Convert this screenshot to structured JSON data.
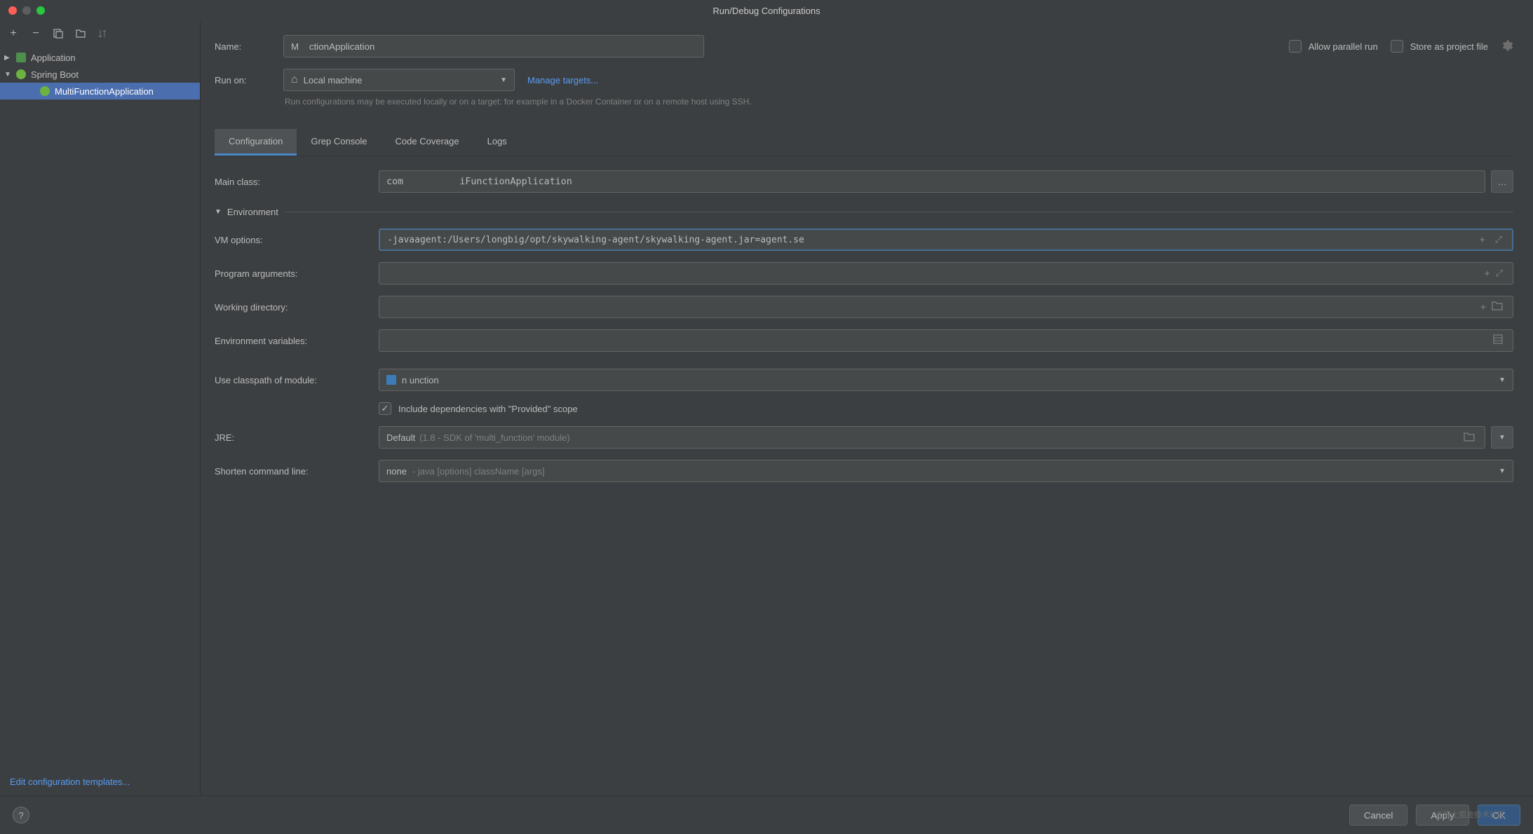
{
  "window": {
    "title": "Run/Debug Configurations"
  },
  "toolbar": {
    "add": "+",
    "remove": "−"
  },
  "sidebar": {
    "nodes": [
      {
        "label": "Application",
        "expanded": false,
        "type": "app"
      },
      {
        "label": "Spring Boot",
        "expanded": true,
        "type": "spring",
        "children": [
          {
            "label": "MultiFunctionApplication",
            "selected": true
          }
        ]
      }
    ],
    "edit_templates": "Edit configuration templates..."
  },
  "form": {
    "name_label": "Name:",
    "name_value": "M    ctionApplication",
    "allow_parallel": "Allow parallel run",
    "store_as_project": "Store as project file",
    "run_on_label": "Run on:",
    "run_on_value": "Local machine",
    "manage_targets": "Manage targets...",
    "run_on_hint": "Run configurations may be executed locally or on a target: for example in a Docker Container or on a remote host using SSH."
  },
  "tabs": [
    {
      "label": "Configuration",
      "active": true
    },
    {
      "label": "Grep Console",
      "active": false
    },
    {
      "label": "Code Coverage",
      "active": false
    },
    {
      "label": "Logs",
      "active": false
    }
  ],
  "config": {
    "main_class_label": "Main class:",
    "main_class_value": "com          iFunctionApplication",
    "env_section": "Environment",
    "vm_options_label": "VM options:",
    "vm_options_value": "-javaagent:/Users/longbig/opt/skywalking-agent/skywalking-agent.jar=agent.se",
    "program_args_label": "Program arguments:",
    "program_args_value": "",
    "working_dir_label": "Working directory:",
    "working_dir_value": "",
    "env_vars_label": "Environment variables:",
    "env_vars_value": "",
    "classpath_label": "Use classpath of module:",
    "classpath_value": "n    unction",
    "include_deps": "Include dependencies with \"Provided\" scope",
    "jre_label": "JRE:",
    "jre_value": "Default",
    "jre_hint": "(1.8 - SDK of 'multi_function' module)",
    "shorten_label": "Shorten command line:",
    "shorten_value": "none",
    "shorten_hint": "- java [options] className [args]"
  },
  "footer": {
    "cancel": "Cancel",
    "apply": "Apply",
    "ok": "OK"
  },
  "watermark": "@稀土掘金技术社区"
}
